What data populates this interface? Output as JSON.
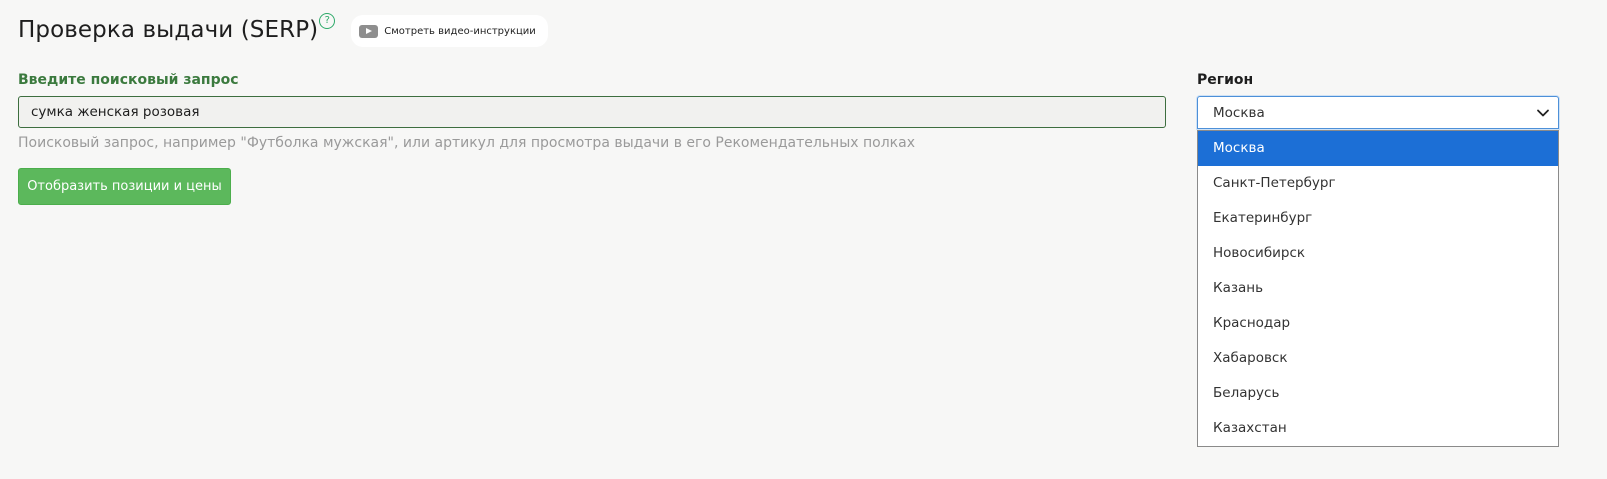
{
  "header": {
    "title": "Проверка выдачи (SERP)",
    "help_glyph": "?",
    "video_button_label": "Смотреть видео-инструкции"
  },
  "search": {
    "label": "Введите поисковый запрос",
    "value": "сумка женская розовая",
    "hint": "Поисковый запрос, например \"Футболка мужская\", или артикул для просмотра выдачи в его Рекомендательных полках",
    "submit_label": "Отобразить позиции и цены"
  },
  "region": {
    "label": "Регион",
    "selected": "Москва",
    "options": [
      "Москва",
      "Санкт-Петербург",
      "Екатеринбург",
      "Новосибирск",
      "Казань",
      "Краснодар",
      "Хабаровск",
      "Беларусь",
      "Казахстан"
    ],
    "highlighted_option": "Москва"
  },
  "colors": {
    "page_background": "#f7f7f6",
    "label_green": "#3b7a3e",
    "button_green": "#5cb85c",
    "help_icon_green": "#2faa6a",
    "highlight_blue": "#1c6fd6",
    "hint_gray": "#9a9a9a"
  },
  "icons": {
    "help": "help-icon",
    "video": "play-icon",
    "select_arrow": "chevron-down-icon"
  }
}
